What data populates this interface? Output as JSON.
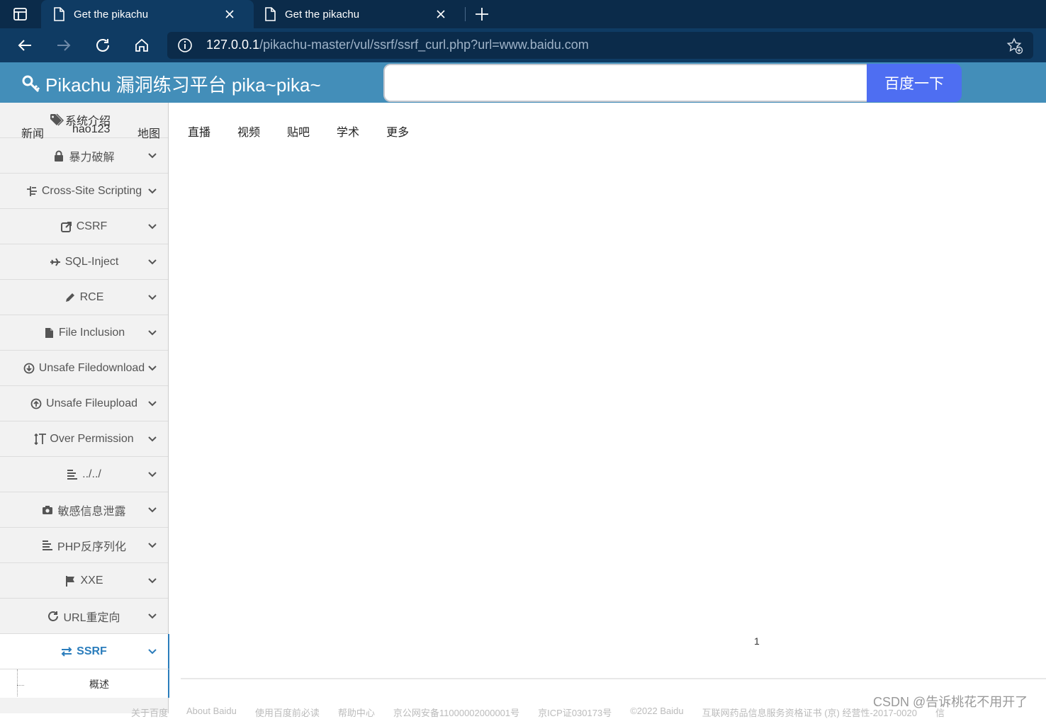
{
  "browser": {
    "tabs": [
      {
        "title": "Get the pikachu"
      },
      {
        "title": "Get the pikachu"
      }
    ],
    "url_host": "127.0.0.1",
    "url_path": "/pikachu-master/vul/ssrf/ssrf_curl.php?url=www.baidu.com"
  },
  "header": {
    "brand": "Pikachu 漏洞练习平台 pika~pika~",
    "search_placeholder": "",
    "search_button": "百度一下"
  },
  "sidebar": {
    "intro_label": "系统介绍",
    "overlap_links": {
      "news": "新闻",
      "hao123": "hao123",
      "map": "地图"
    },
    "items": [
      {
        "label": "暴力破解",
        "icon": "lock-icon"
      },
      {
        "label": "Cross-Site Scripting",
        "icon": "sitemap-icon"
      },
      {
        "label": "CSRF",
        "icon": "share-icon"
      },
      {
        "label": "SQL-Inject",
        "icon": "plane-icon"
      },
      {
        "label": "RCE",
        "icon": "pencil-icon"
      },
      {
        "label": "File Inclusion",
        "icon": "file-icon"
      },
      {
        "label": "Unsafe Filedownload",
        "icon": "download-icon"
      },
      {
        "label": "Unsafe Fileupload",
        "icon": "upload-icon"
      },
      {
        "label": "Over Permission",
        "icon": "text-height-icon"
      },
      {
        "label": "../../",
        "icon": "align-icon"
      },
      {
        "label": "敏感信息泄露",
        "icon": "camera-icon"
      },
      {
        "label": "PHP反序列化",
        "icon": "align-icon"
      },
      {
        "label": "XXE",
        "icon": "flag-icon"
      },
      {
        "label": "URL重定向",
        "icon": "refresh-icon"
      },
      {
        "label": "SSRF",
        "icon": "exchange-icon"
      }
    ],
    "sub_item": "概述"
  },
  "main": {
    "links": [
      "直播",
      "视频",
      "贴吧",
      "学术",
      "更多"
    ],
    "page_number": "1",
    "footer": [
      "关于百度",
      "About Baidu",
      "使用百度前必读",
      "帮助中心",
      "京公网安备11000002000001号",
      "京ICP证030173号",
      "©2022 Baidu",
      "互联网药品信息服务资格证书 (京) 经营性-2017-0020",
      "信"
    ],
    "watermark": "CSDN @告诉桃花不用开了"
  },
  "colors": {
    "accent": "#438eb9",
    "search_button": "#4e6ef2",
    "active": "#2b7dbc"
  }
}
